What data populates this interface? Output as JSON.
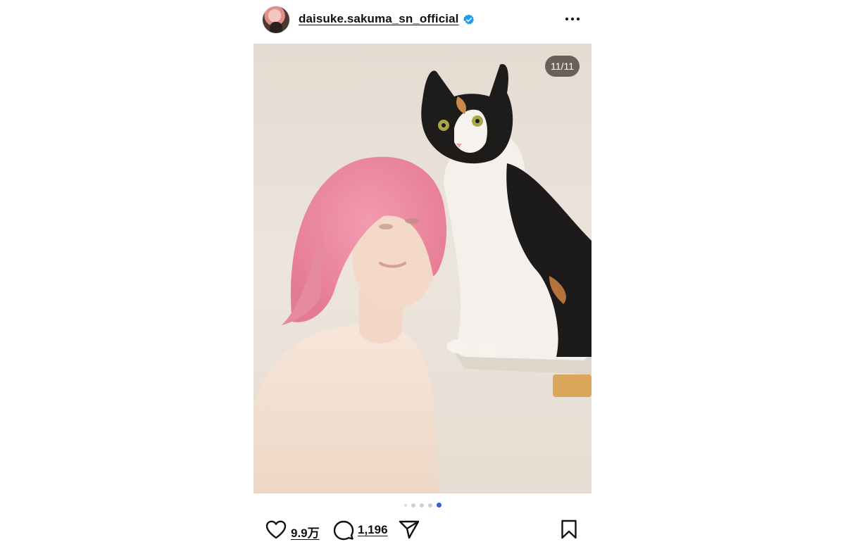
{
  "header": {
    "username": "daisuke.sakuma_sn_official",
    "avatar_icon": "profile-avatar",
    "verified_icon": "verified-badge-icon",
    "verified_color": "#1d9bf0",
    "more_icon": "more-horizontal-icon"
  },
  "photo": {
    "counter": "11/11",
    "slide_current": 11,
    "slide_total": 11
  },
  "carousel": {
    "active_color": "#3f5bd6"
  },
  "actions": {
    "like_icon": "heart-icon",
    "like_count": "9.9万",
    "comment_icon": "comment-icon",
    "comment_count": "1,196",
    "share_icon": "share-send-icon",
    "save_icon": "bookmark-icon"
  }
}
